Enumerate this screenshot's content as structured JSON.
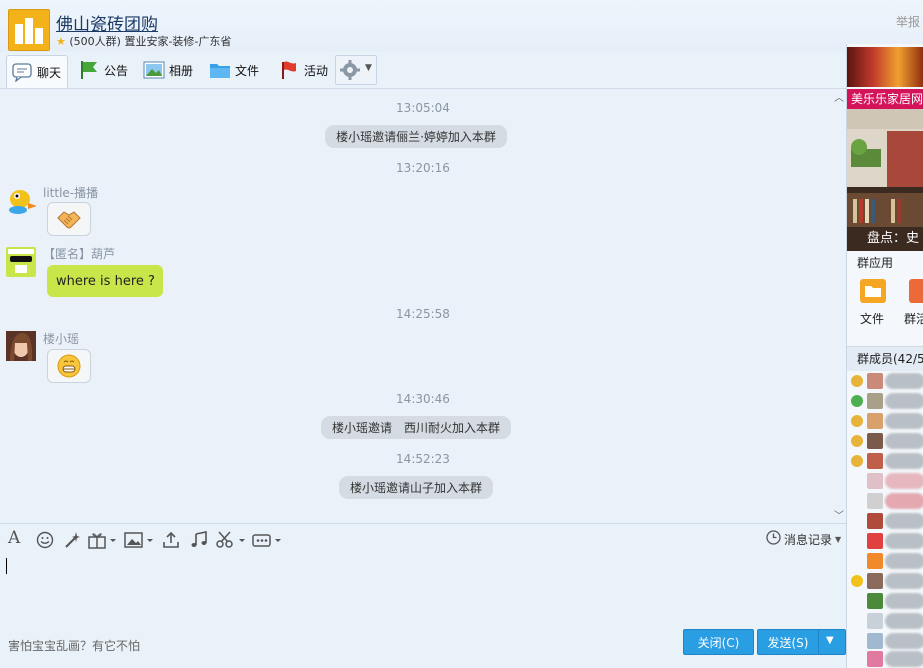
{
  "header": {
    "group_name": "佛山瓷砖团购",
    "group_meta": "(500人群) 置业安家-装修-广东省",
    "report": "举报"
  },
  "toolbar": {
    "tabs": [
      {
        "label": "聊天",
        "icon": "chat-icon"
      },
      {
        "label": "公告",
        "icon": "announcement-flag-icon"
      },
      {
        "label": "相册",
        "icon": "album-icon"
      },
      {
        "label": "文件",
        "icon": "folder-icon"
      },
      {
        "label": "活动",
        "icon": "activity-flag-icon"
      }
    ],
    "settings_icon": "gear-icon"
  },
  "chat": {
    "times": [
      "13:05:04",
      "13:20:16",
      "14:25:58",
      "14:30:46",
      "14:52:23"
    ],
    "system_messages": [
      "楼小瑶邀请俪兰·婷婷加入本群",
      "楼小瑶邀请　西川耐火加入本群",
      "楼小瑶邀请山子加入本群"
    ],
    "messages": [
      {
        "sender": "little-播播",
        "content": "handshake-emoji"
      },
      {
        "sender": "【匿名】葫芦",
        "content": "where is here ?"
      },
      {
        "sender": "楼小瑶",
        "content": "grin-emoji"
      }
    ]
  },
  "input_toolbar": {
    "icons": [
      "font-icon",
      "emoji-icon",
      "magic-icon",
      "gift-icon",
      "image-icon",
      "upload-icon",
      "music-icon",
      "screenshot-icon",
      "more-icon"
    ],
    "history_label": "消息记录"
  },
  "footer": {
    "tip": "害怕宝宝乱画？有它不怕",
    "close_label": "关闭(C)",
    "send_label": "发送(S)"
  },
  "right_panel": {
    "ad_title": "美乐乐家居网",
    "ad_caption": "盘点：史",
    "apps_title": "群应用",
    "apps": [
      "文件",
      "群活"
    ],
    "members_header": "群成员(42/5"
  },
  "colors": {
    "accent": "#2a9ee3",
    "bubble_green": "#c8e64a",
    "system_bubble": "#d4dbe3",
    "ad_bar": "#d4145a"
  }
}
